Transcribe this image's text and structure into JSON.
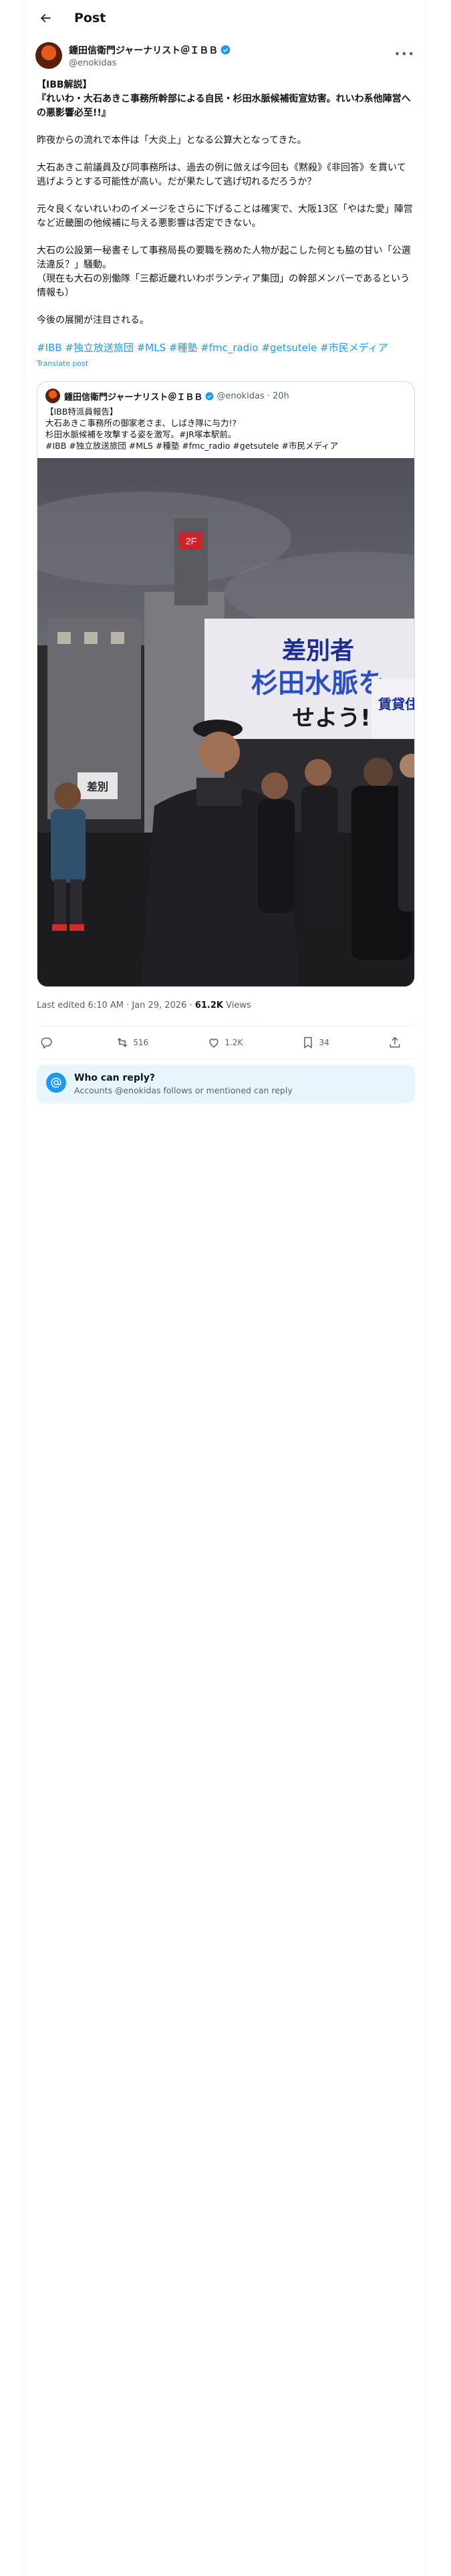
{
  "header": {
    "title": "Post"
  },
  "author": {
    "display_name": "鍾田信衛門ジャーナリスト＠ＩＢＢ",
    "handle": "@enokidas"
  },
  "post": {
    "title_line1": "【IBB解説】",
    "title_line2": "『れいわ・大石あきこ事務所幹部による自民・杉田水脈候補街宣妨害。れいわ系他陣営への悪影響必至!!』",
    "para1": "昨夜からの流れで本件は「大炎上」となる公算大となってきた。",
    "para2": "大石あきこ前議員及び同事務所は、過去の例に倣えば今回も《黙殺》《非回答》を貫いて逃げようとする可能性が高い。だが果たして逃げ切れるだろうか？",
    "para3": "元々良くないれいわのイメージをさらに下げることは確実で、大阪13区「やはた愛」陣営など近畿圏の他候補に与える悪影響は否定できない。",
    "para4": "大石の公設第一秘書そして事務局長の要職を務めた人物が起こした何とも脇の甘い「公選法違反？」騒動。\n（現在も大石の別働隊「三都近畿れいわボランティア集団」の幹部メンバーであるという情報も）",
    "para5": "今後の展開が注目される。",
    "hashtags": "#IBB #独立放送旅団 #MLS #種塾 #fmc_radio #getsutele #市民メディア",
    "translate": "Translate post"
  },
  "quote": {
    "display_name": "鍾田信衛門ジャーナリスト＠ＩＢＢ",
    "handle": "@enokidas",
    "time": "· 20h",
    "text": "【IBB特派員報告】\n大石あきこ事務所の御家老さま、しばき隊に与力!?\n杉田水脈候補を攻撃する姿を激写。#JR塚本駅前。\n#IBB #独立放送旅団 #MLS #種塾 #fmc_radio #getsutele #市民メディア",
    "photo": {
      "sign_title": "杉田水脈を",
      "sign_top": "差別者",
      "sign_bottom": "せよう!",
      "sign_side": "賃貸住宅",
      "sign_small": "差別",
      "neon": "2F"
    }
  },
  "meta": {
    "edited": "Last edited 6:10 AM · Jan 29, 2026 · ",
    "views_count": "61.2K",
    "views_label": " Views"
  },
  "actions": {
    "reposts": "516",
    "likes": "1.2K",
    "bookmarks": "34"
  },
  "reply": {
    "title": "Who can reply?",
    "subtitle": "Accounts @enokidas follows or mentioned can reply"
  },
  "colors": {
    "accent": "#1d9bf0",
    "text": "#0f1419",
    "muted": "#536471"
  },
  "icons": [
    "back-arrow-icon",
    "verified-badge-icon",
    "more-icon",
    "reply-icon",
    "repost-icon",
    "like-icon",
    "bookmark-icon",
    "share-icon",
    "at-sign-icon"
  ]
}
